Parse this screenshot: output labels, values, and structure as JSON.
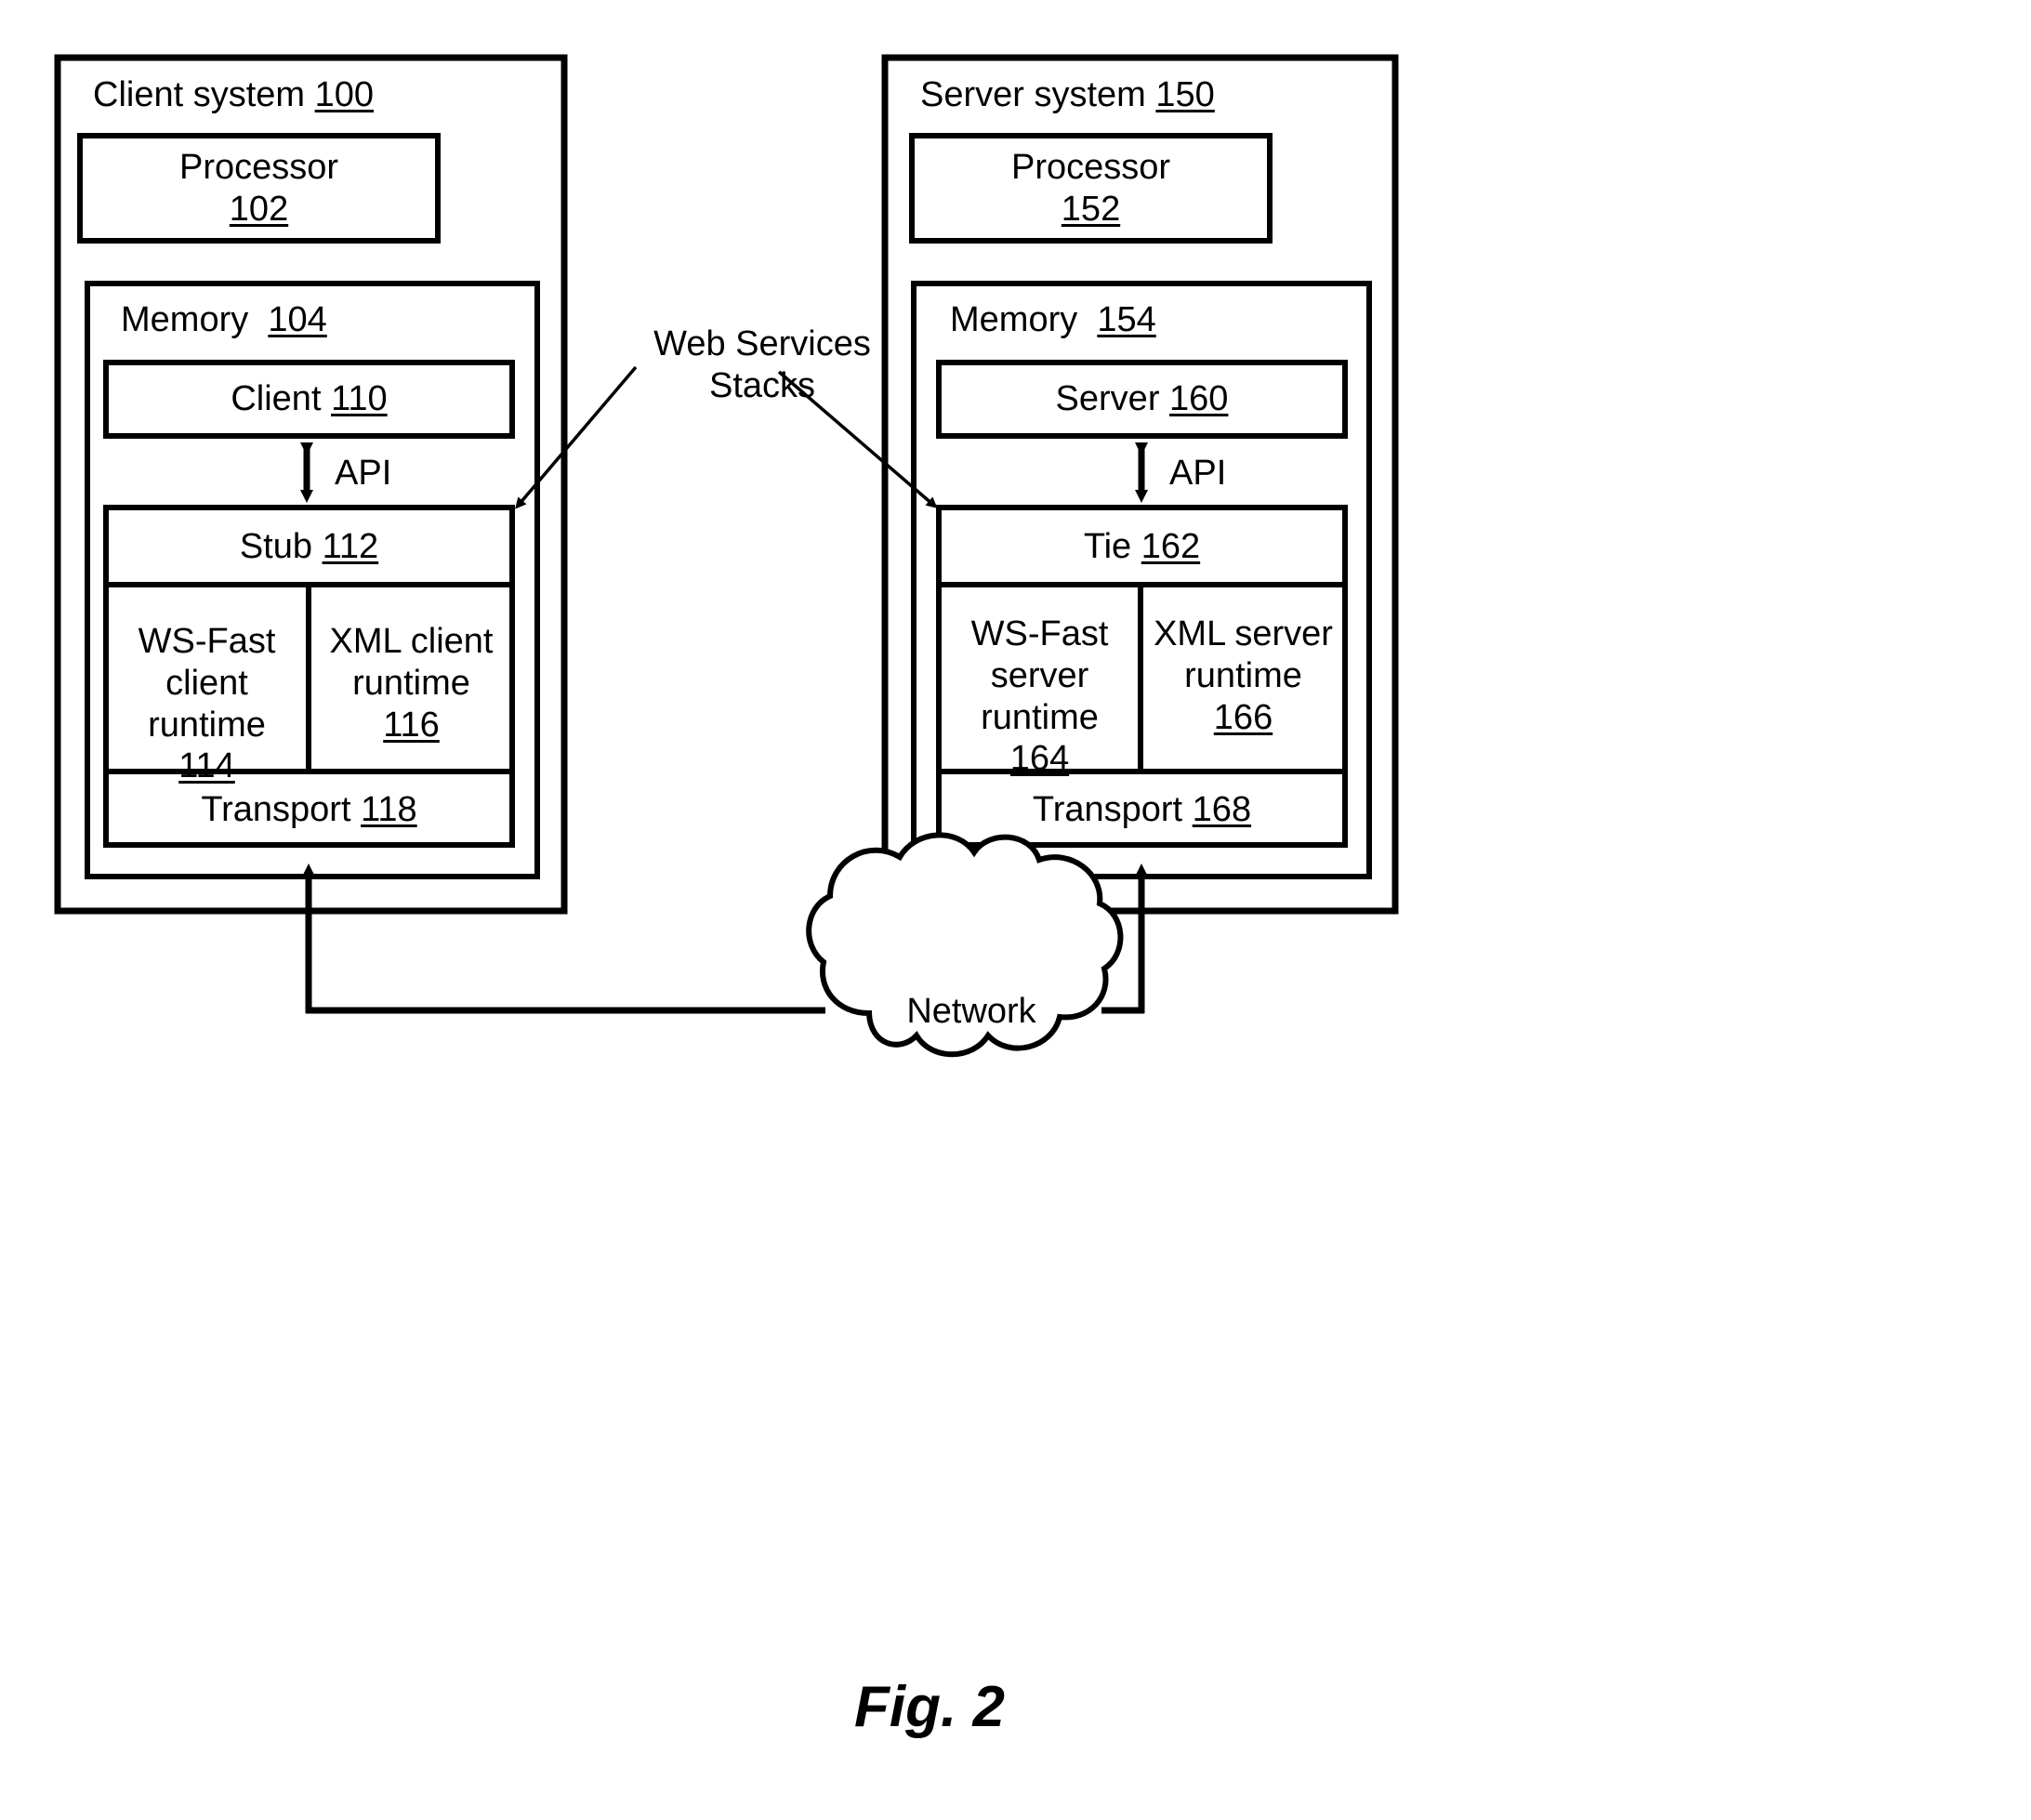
{
  "figure": {
    "caption": "Fig. 2"
  },
  "annotation": {
    "line1": "Web Services",
    "line2": "Stacks"
  },
  "network": {
    "label": "Network"
  },
  "client_system": {
    "title": "Client system",
    "ref": "100",
    "processor": {
      "title": "Processor",
      "ref": "102"
    },
    "memory": {
      "title": "Memory",
      "ref": "104",
      "client": {
        "title": "Client",
        "ref": "110"
      },
      "api_label": "API",
      "stack": {
        "top": {
          "title": "Stub",
          "ref": "112"
        },
        "runtimes": [
          {
            "title": "WS-Fast client runtime",
            "ref": "114"
          },
          {
            "title": "XML client runtime",
            "ref": "116"
          }
        ],
        "transport": {
          "title": "Transport",
          "ref": "118"
        }
      }
    }
  },
  "server_system": {
    "title": "Server system",
    "ref": "150",
    "processor": {
      "title": "Processor",
      "ref": "152"
    },
    "memory": {
      "title": "Memory",
      "ref": "154",
      "server": {
        "title": "Server",
        "ref": "160"
      },
      "api_label": "API",
      "stack": {
        "top": {
          "title": "Tie",
          "ref": "162"
        },
        "runtimes": [
          {
            "title": "WS-Fast server runtime",
            "ref": "164"
          },
          {
            "title": "XML server runtime",
            "ref": "166"
          }
        ],
        "transport": {
          "title": "Transport",
          "ref": "168"
        }
      }
    }
  },
  "colors": {
    "stroke": "#000000",
    "background": "#ffffff"
  }
}
